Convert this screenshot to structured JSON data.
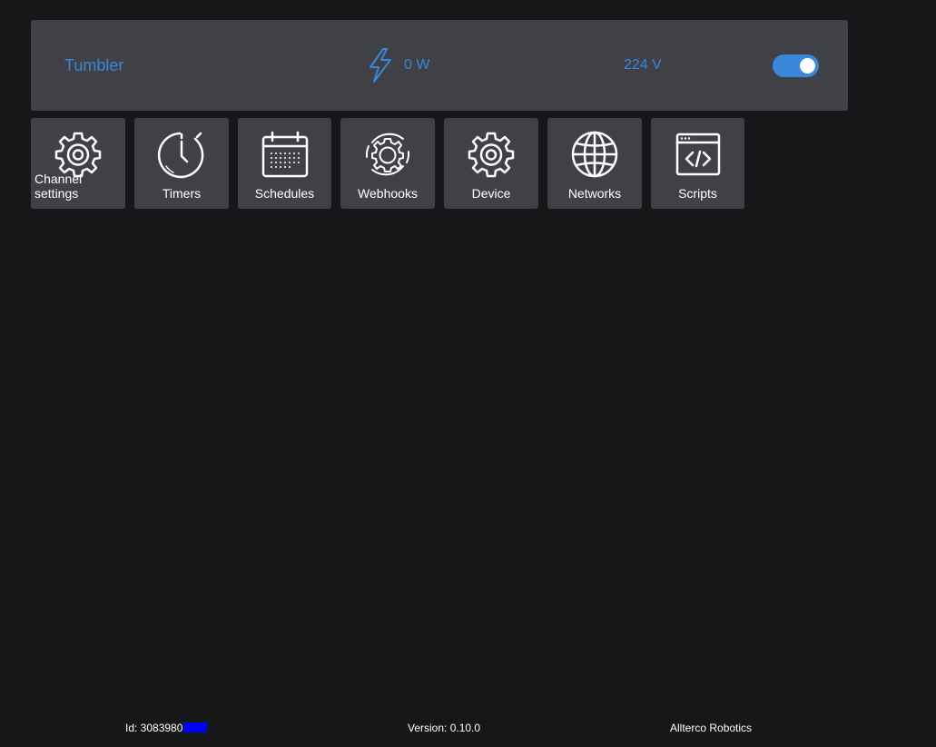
{
  "status": {
    "channel_name": "Tumbler",
    "power": "0 W",
    "voltage": "224 V",
    "power_icon": "lightning-bolt-icon",
    "toggle_on": true,
    "accent_color": "#3a86d8"
  },
  "tiles": [
    {
      "label": "Channel settings",
      "icon": "gear-icon"
    },
    {
      "label": "Timers",
      "icon": "stopwatch-icon"
    },
    {
      "label": "Schedules",
      "icon": "calendar-icon"
    },
    {
      "label": "Webhooks",
      "icon": "gear-cycle-icon"
    },
    {
      "label": "Device",
      "icon": "gear-icon"
    },
    {
      "label": "Networks",
      "icon": "globe-icon"
    },
    {
      "label": "Scripts",
      "icon": "code-window-icon"
    }
  ],
  "footer": {
    "id": "Id: 30839809",
    "version": "Version: 0.10.0",
    "vendor": "Allterco Robotics"
  }
}
